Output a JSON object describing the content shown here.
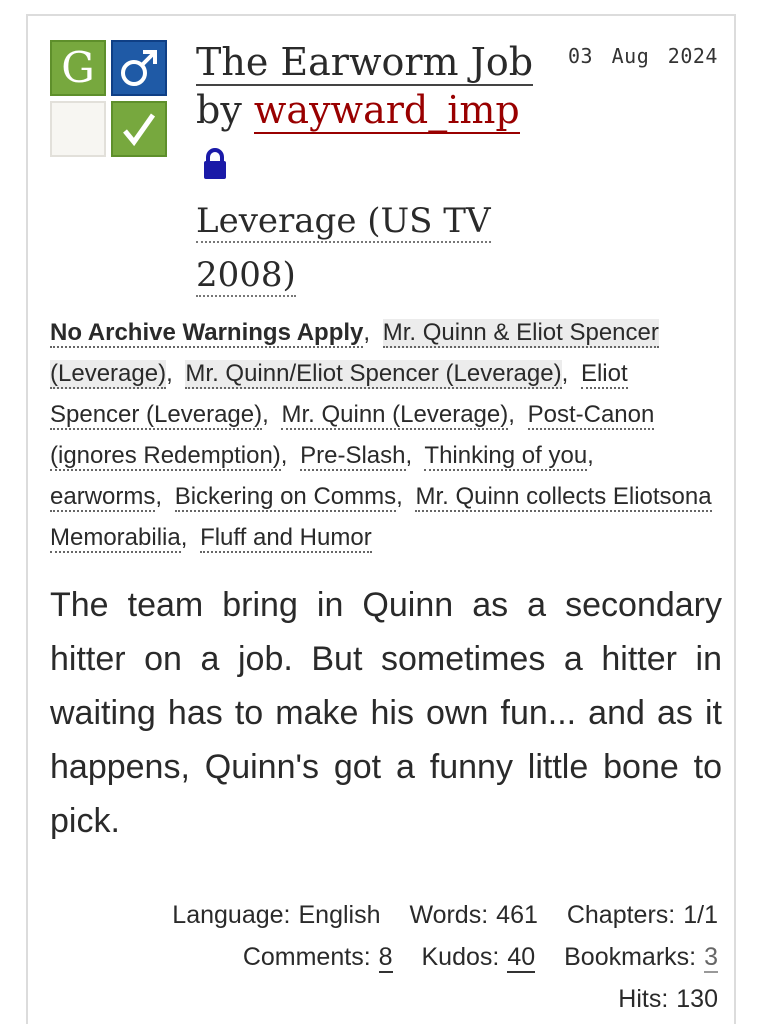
{
  "required_tags": {
    "rating_letter": "G",
    "category_symbol": "♂",
    "complete_symbol": "✓",
    "colors": {
      "rating": "#77a83e",
      "category": "#1f5aa6",
      "complete": "#77a83e",
      "warning_none": "#f7f6f2"
    }
  },
  "date": "03 Aug 2024",
  "work": {
    "title": "The Earworm Job",
    "by": "by",
    "author": "wayward_imp",
    "restricted_icon": "lock-icon",
    "fandom": "Leverage (US TV 2008)"
  },
  "tags": {
    "warning": "No Archive Warnings Apply",
    "relationships": [
      "Mr. Quinn & Eliot Spencer (Leverage)",
      "Mr. Quinn/Eliot Spencer (Leverage)"
    ],
    "characters": [
      "Eliot Spencer (Leverage)",
      "Mr. Quinn (Leverage)"
    ],
    "freeforms": [
      "Post-Canon (ignores Redemption)",
      "Pre-Slash",
      "Thinking of you",
      "earworms",
      "Bickering on Comms",
      "Mr. Quinn collects Eliotsona Memorabilia",
      "Fluff and Humor"
    ]
  },
  "summary": "The team bring in Quinn as a secondary hitter on a job. But sometimes a hitter in waiting has to make his own fun... and as it happens, Quinn's got a funny little bone to pick.",
  "stats": {
    "language_label": "Language:",
    "language": "English",
    "words_label": "Words:",
    "words": "461",
    "chapters_label": "Chapters:",
    "chapters": "1/1",
    "comments_label": "Comments:",
    "comments": "8",
    "kudos_label": "Kudos:",
    "kudos": "40",
    "bookmarks_label": "Bookmarks:",
    "bookmarks": "3",
    "hits_label": "Hits:",
    "hits": "130"
  }
}
